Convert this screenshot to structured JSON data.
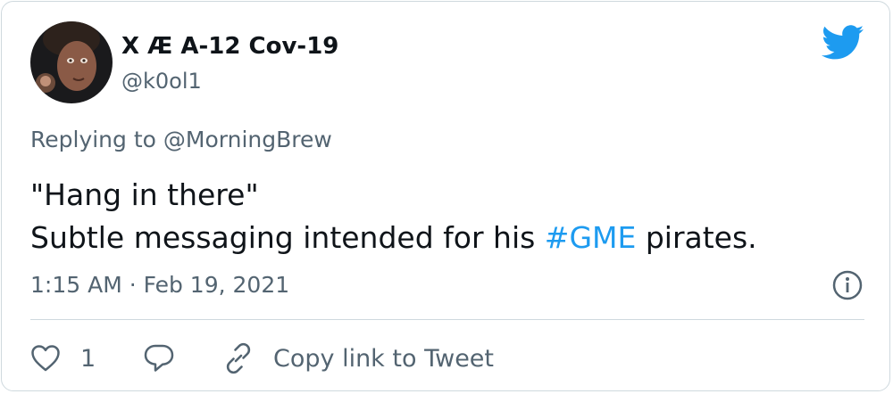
{
  "tweet": {
    "author": {
      "display_name": "X Æ A-12 Cov-19",
      "handle": "@k0ol1"
    },
    "replying_to": "Replying to @MorningBrew",
    "text": {
      "line1": "\"Hang in there\"",
      "line2_before": "Subtle messaging intended for his ",
      "hashtag": "#GME",
      "line2_after": " pirates."
    },
    "timestamp": "1:15 AM · Feb 19, 2021",
    "actions": {
      "like_count": "1",
      "copy_link_label": "Copy link to Tweet"
    }
  },
  "icons": {
    "brand": "twitter-bird-icon",
    "info": "info-icon",
    "like": "heart-icon",
    "reply": "reply-bubble-icon",
    "copy_link": "link-icon"
  },
  "colors": {
    "brand_blue": "#1d9bf0",
    "text_primary": "#0f1419",
    "text_secondary": "#536471",
    "border": "#cfd9de"
  }
}
